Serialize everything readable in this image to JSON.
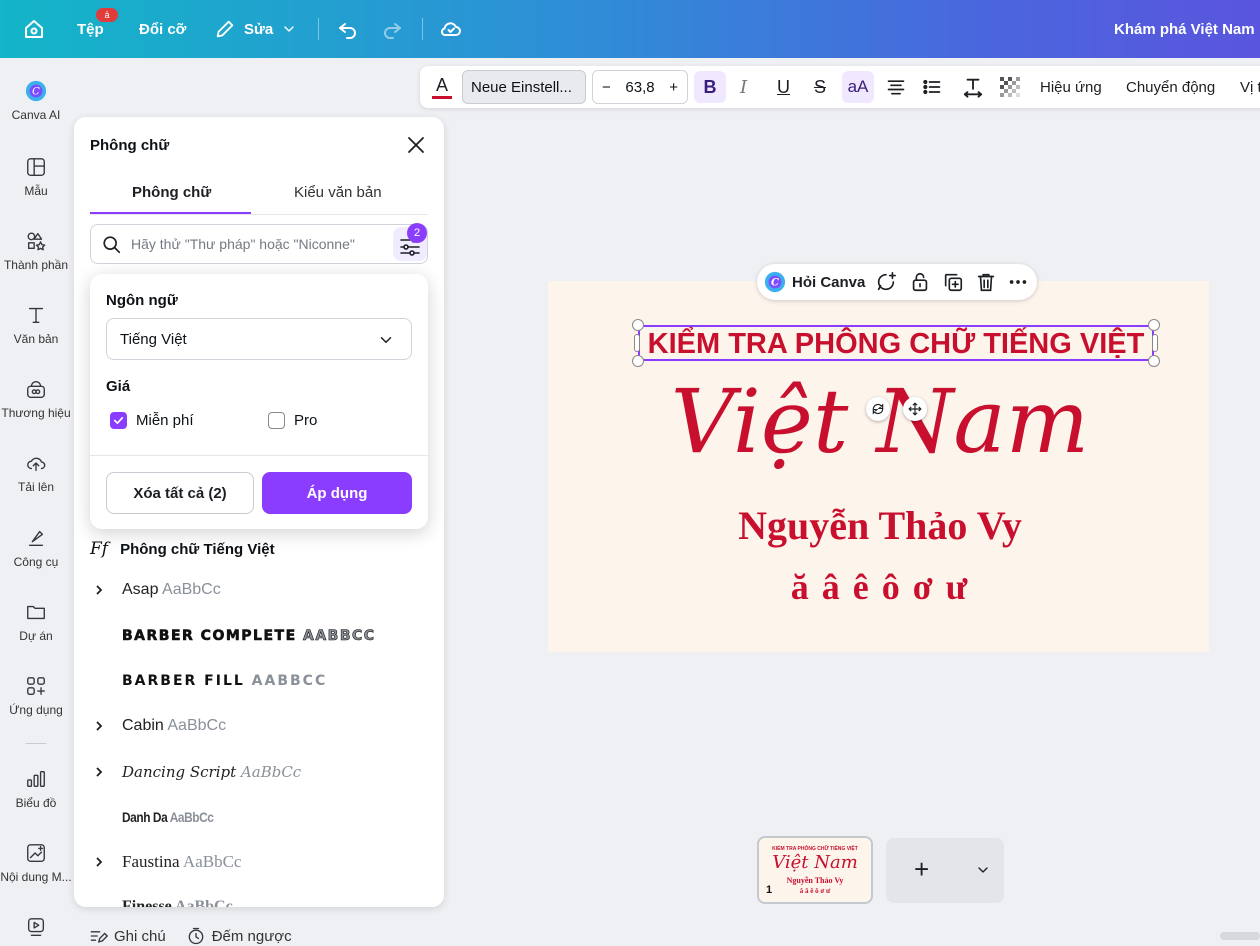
{
  "topbar": {
    "file_label": "Tệp",
    "file_badge": "ả",
    "resize_label": "Đổi cỡ",
    "edit_label": "Sửa",
    "right_title": "Khám phá Việt Nam"
  },
  "rail": {
    "items": [
      {
        "label": "Canva AI",
        "icon": "canva-ai-icon"
      },
      {
        "label": "Mẫu",
        "icon": "template-icon"
      },
      {
        "label": "Thành phần",
        "icon": "elements-icon"
      },
      {
        "label": "Văn bản",
        "icon": "text-icon"
      },
      {
        "label": "Thương hiệu",
        "icon": "brand-icon"
      },
      {
        "label": "Tải lên",
        "icon": "upload-icon"
      },
      {
        "label": "Công cụ",
        "icon": "tools-icon"
      },
      {
        "label": "Dự án",
        "icon": "folder-icon"
      },
      {
        "label": "Ứng dụng",
        "icon": "apps-icon"
      },
      {
        "label": "Biểu đồ",
        "icon": "chart-icon"
      },
      {
        "label": "Nội dung M...",
        "icon": "magic-media-icon"
      }
    ]
  },
  "panel": {
    "title": "Phông chữ",
    "tabs": [
      "Phông chữ",
      "Kiểu văn bản"
    ],
    "search_placeholder": "Hãy thử \"Thư pháp\" hoặc \"Niconne\"",
    "filter_count": "2",
    "filter_popup": {
      "language_label": "Ngôn ngữ",
      "language_value": "Tiếng Việt",
      "price_label": "Giá",
      "free_label": "Miễn phí",
      "free_checked": true,
      "pro_label": "Pro",
      "pro_checked": false,
      "clear_button": "Xóa tất cả (2)",
      "apply_button": "Áp dụng"
    },
    "section_icon_text": "Ff",
    "section_title": "Phông chữ Tiếng Việt",
    "fonts": [
      {
        "name": "Asap",
        "sample": "AaBbCc",
        "expandable": true
      },
      {
        "name": "BARBER COMPLETE",
        "sample": "AABBCC",
        "expandable": false
      },
      {
        "name": "BARBER FILL",
        "sample": "AABBCC",
        "expandable": false
      },
      {
        "name": "Cabin",
        "sample": "AaBbCc",
        "expandable": true
      },
      {
        "name": "Dancing Script",
        "sample": "AaBbCc",
        "expandable": true
      },
      {
        "name": "Danh Da",
        "sample": "AaBbCc",
        "expandable": false
      },
      {
        "name": "Faustina",
        "sample": "AaBbCc",
        "expandable": true
      },
      {
        "name": "Finesse",
        "sample": "AaBbCc",
        "expandable": false
      }
    ]
  },
  "bottom": {
    "notes_label": "Ghi chú",
    "timer_label": "Đếm ngược"
  },
  "toolbar": {
    "font_name": "Neue Einstell...",
    "font_size": "63,8",
    "minus": "−",
    "plus": "+",
    "case_label": "aA",
    "effects_label": "Hiệu ứng",
    "animate_label": "Chuyển động",
    "position_label": "Vị t",
    "text_color": "#c8102e"
  },
  "context_bar": {
    "ask_label": "Hỏi Canva"
  },
  "canvas": {
    "background": "#fdf4ec",
    "text_color": "#c8102e",
    "heading": "KIỂM TRA PHÔNG CHỮ TIẾNG VIỆT",
    "script_title": "Việt Nam",
    "name": "Nguyễn Thảo Vy",
    "letters": "ă â ê ô ơ ư"
  },
  "pages": {
    "thumb_number": "1",
    "thumb_heading": "KIỂM TRA PHÔNG CHỮ TIẾNG VIỆT",
    "thumb_script": "Việt Nam",
    "thumb_name": "Nguyễn Thảo Vy",
    "thumb_letters": "ă â ê ô ơ ư",
    "add_label": "+"
  },
  "colors": {
    "accent": "#8b3dff",
    "canvas_text": "#c8102e"
  }
}
